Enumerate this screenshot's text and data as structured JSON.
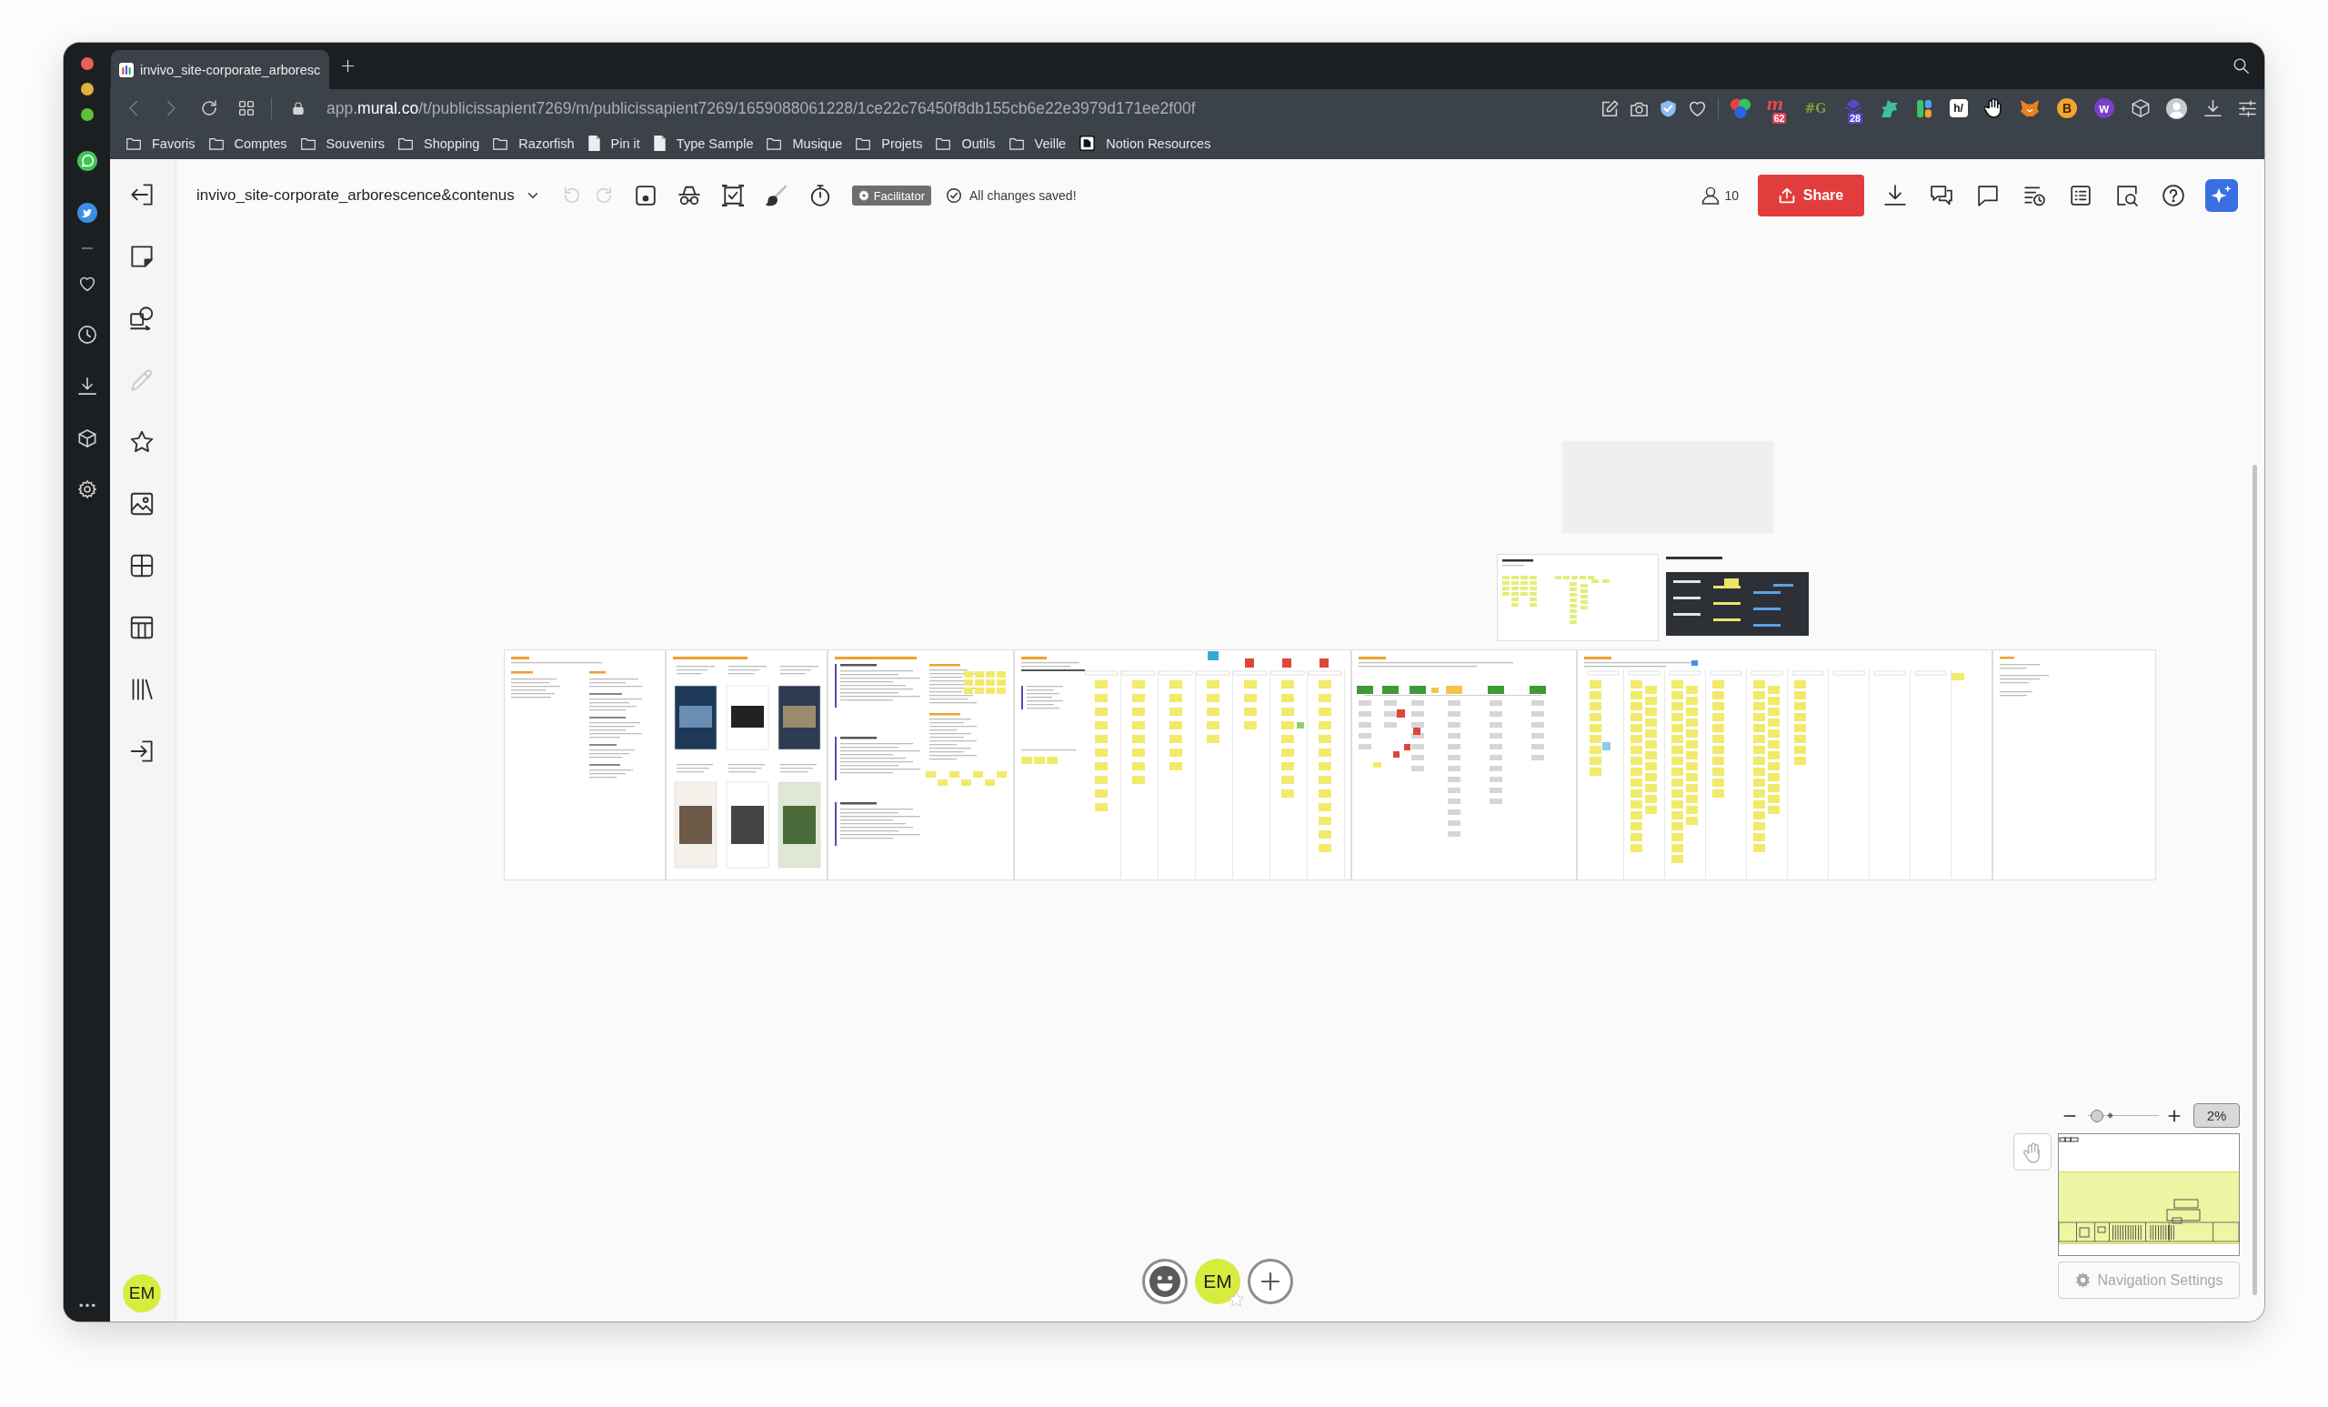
{
  "browser": {
    "tabs": [
      {
        "title": "invivo_site-corporate_arboresc",
        "selected": true
      }
    ],
    "url": "app.**mural.co**/t/publicissapient7269/m/publicissapient7269/1659088061228/1ce22c76450f8db155cb6e22e3979d171ee2f00f",
    "extensions": [
      {
        "kind": "circles"
      },
      {
        "kind": "script",
        "glyph": "m",
        "badge": "62"
      },
      {
        "kind": "mono",
        "glyph": "#G"
      },
      {
        "kind": "stack",
        "badge": "28"
      },
      {
        "kind": "dino"
      },
      {
        "kind": "tiles"
      },
      {
        "kind": "tile",
        "glyph": "h/"
      },
      {
        "kind": "hand"
      },
      {
        "kind": "fox"
      },
      {
        "kind": "disc",
        "glyph": "B",
        "color": "#f2a431"
      },
      {
        "kind": "disc",
        "glyph": "w",
        "color": "#7a3ec8"
      },
      {
        "kind": "cube"
      },
      {
        "kind": "profile"
      }
    ],
    "bookmarks": [
      {
        "kind": "folder",
        "label": "Favoris"
      },
      {
        "kind": "folder",
        "label": "Comptes"
      },
      {
        "kind": "folder",
        "label": "Souvenirs"
      },
      {
        "kind": "folder",
        "label": "Shopping"
      },
      {
        "kind": "folder",
        "label": "Razorfish"
      },
      {
        "kind": "page",
        "label": "Pin it"
      },
      {
        "kind": "page",
        "label": "Type Sample"
      },
      {
        "kind": "folder",
        "label": "Musique"
      },
      {
        "kind": "folder",
        "label": "Projets"
      },
      {
        "kind": "folder",
        "label": "Outils"
      },
      {
        "kind": "folder",
        "label": "Veille"
      },
      {
        "kind": "notion",
        "label": "Notion Resources"
      }
    ]
  },
  "sidebar": {
    "tools": [
      {
        "kind": "exit",
        "disabled": false
      },
      {
        "kind": "sticky",
        "disabled": false
      },
      {
        "kind": "shapes",
        "disabled": false
      },
      {
        "kind": "pen",
        "disabled": true
      },
      {
        "kind": "star",
        "disabled": false
      },
      {
        "kind": "image",
        "disabled": false
      },
      {
        "kind": "grid",
        "disabled": false
      },
      {
        "kind": "table",
        "disabled": false
      },
      {
        "kind": "library",
        "disabled": false
      },
      {
        "kind": "import",
        "disabled": false
      }
    ],
    "user": {
      "initials": "EM"
    }
  },
  "toolbar": {
    "title": "invivo_site-corporate_arborescence&contenus",
    "tools": [
      {
        "kind": "undo",
        "disabled": true
      },
      {
        "kind": "redo",
        "disabled": true
      },
      {
        "kind": "frame",
        "disabled": false
      },
      {
        "kind": "private",
        "disabled": false
      },
      {
        "kind": "select",
        "disabled": false
      },
      {
        "kind": "brush",
        "disabled": false
      },
      {
        "kind": "timer",
        "disabled": false
      }
    ],
    "role": "Facilitator",
    "status": "All changes saved!",
    "participants": "10",
    "share": "Share"
  },
  "presence": {
    "initials": "EM",
    "facilitator": true
  },
  "zoom": {
    "level": 0.05,
    "reading": "2%"
  },
  "navigation": {
    "label": "Navigation Settings"
  }
}
